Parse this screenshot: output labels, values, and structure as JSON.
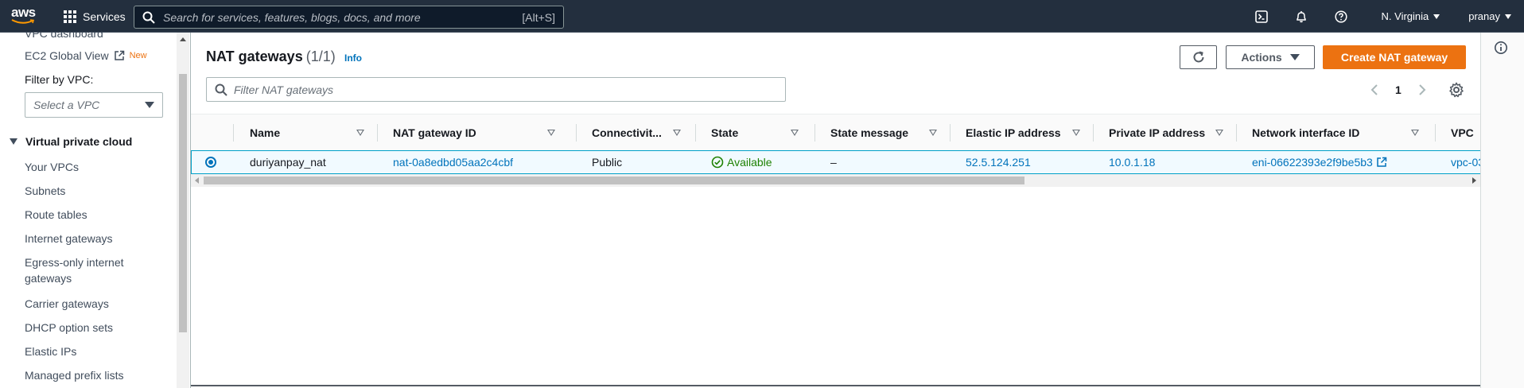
{
  "topnav": {
    "logo_text": "aws",
    "services_label": "Services",
    "search_placeholder": "Search for services, features, blogs, docs, and more",
    "search_shortcut": "[Alt+S]",
    "region": "N. Virginia",
    "user": "pranay",
    "icons": [
      "cloudshell-icon",
      "bell-icon",
      "help-icon"
    ]
  },
  "sidebar": {
    "partial_item": "VPC dashboard",
    "ec2_global_view": "EC2 Global View",
    "new_badge": "New",
    "filter_label": "Filter by VPC:",
    "filter_placeholder": "Select a VPC",
    "section_title": "Virtual private cloud",
    "items": [
      "Your VPCs",
      "Subnets",
      "Route tables",
      "Internet gateways",
      "Egress-only internet",
      "gateways",
      "Carrier gateways",
      "DHCP option sets",
      "Elastic IPs",
      "Managed prefix lists"
    ]
  },
  "main": {
    "title": "NAT gateways",
    "count": "(1/1)",
    "info": "Info",
    "actions_label": "Actions",
    "create_label": "Create NAT gateway",
    "filter_placeholder": "Filter NAT gateways",
    "page_number": "1",
    "columns": [
      "Name",
      "NAT gateway ID",
      "Connectivit...",
      "State",
      "State message",
      "Elastic IP address",
      "Private IP address",
      "Network interface ID",
      "VPC"
    ],
    "rows": [
      {
        "name": "duriyanpay_nat",
        "nat_id": "nat-0a8edbd05aa2c4cbf",
        "connectivity": "Public",
        "state": "Available",
        "state_message": "–",
        "elastic_ip": "52.5.124.251",
        "private_ip": "10.0.1.18",
        "eni": "eni-06622393e2f9be5b3",
        "vpc": "vpc-03"
      }
    ]
  },
  "colors": {
    "nav_bg": "#232f3e",
    "primary": "#ec7211",
    "link": "#0073bb",
    "success": "#1d8102",
    "selected_row_bg": "#f1faff",
    "selected_row_border": "#00a1c9"
  }
}
